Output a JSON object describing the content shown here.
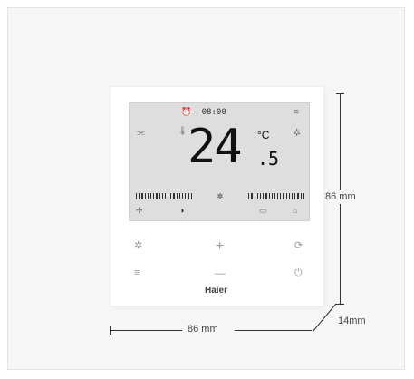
{
  "device": {
    "brand": "Haier",
    "clock": "08:00",
    "temperature": {
      "integer": "24",
      "decimal": ".5",
      "unit": "°C"
    },
    "fan_speed_symbol": "✲",
    "icons": {
      "clock": "alarm-clock-icon",
      "wifi": "wifi-icon",
      "swing": "swing-vents-icon",
      "thermo": "thermometer-icon",
      "mode": "snowflake-icon",
      "fan_left": "fan-low-icon",
      "sleep": "moon-icon",
      "filter": "filter-icon",
      "lock": "lock-icon"
    },
    "buttons": {
      "fan_label": "✲",
      "plus_label": "+",
      "mode_label": "⟳",
      "menu_label": "≡",
      "minus_label": "—",
      "power_label": "⏻"
    }
  },
  "dimensions": {
    "height": "86 mm",
    "width": "86 mm",
    "depth": "14mm"
  }
}
